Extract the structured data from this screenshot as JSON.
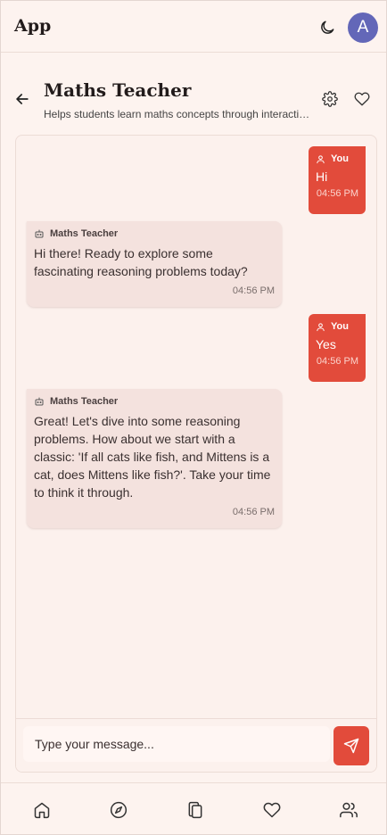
{
  "app": {
    "title": "App",
    "avatar_letter": "A"
  },
  "chat": {
    "title": "Maths Teacher",
    "description": "Helps students learn maths concepts through interactive lessons and reasoning problems"
  },
  "messages": [
    {
      "role": "user",
      "sender": "You",
      "text": "Hi",
      "time": "04:56 PM"
    },
    {
      "role": "bot",
      "sender": "Maths Teacher",
      "text": "Hi there! Ready to explore some fascinating reasoning problems today?",
      "time": "04:56 PM"
    },
    {
      "role": "user",
      "sender": "You",
      "text": "Yes",
      "time": "04:56 PM"
    },
    {
      "role": "bot",
      "sender": "Maths Teacher",
      "text": "Great! Let's dive into some reasoning problems. How about we start with a classic: 'If all cats like fish, and Mittens is a cat, does Mittens like fish?'. Take your time to think it through.",
      "time": "04:56 PM"
    }
  ],
  "composer": {
    "placeholder": "Type your message..."
  },
  "colors": {
    "accent": "#e24b3b",
    "avatar": "#6367b8",
    "background": "#fdf3ef",
    "bot_bubble": "#f4e2de"
  },
  "nav": [
    "home-icon",
    "compass-icon",
    "copy-icon",
    "heart-icon",
    "users-icon"
  ]
}
